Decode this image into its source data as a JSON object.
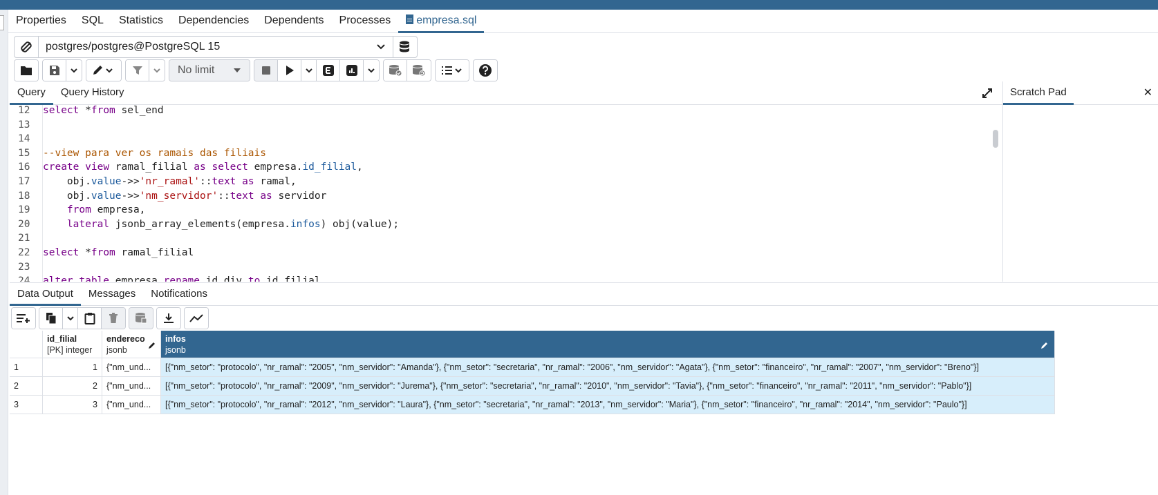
{
  "main_tabs": [
    {
      "label": "Properties"
    },
    {
      "label": "SQL"
    },
    {
      "label": "Statistics"
    },
    {
      "label": "Dependencies"
    },
    {
      "label": "Dependents"
    },
    {
      "label": "Processes"
    },
    {
      "label": "empresa.sql",
      "active": true
    }
  ],
  "connection": {
    "value": "postgres/postgres@PostgreSQL 15"
  },
  "toolbar": {
    "limit_label": "No limit"
  },
  "query_tabs": [
    {
      "label": "Query",
      "active": true
    },
    {
      "label": "Query History"
    }
  ],
  "scratch_pad": {
    "label": "Scratch Pad",
    "close": "✕"
  },
  "editor": {
    "lines": [
      {
        "n": "12",
        "code": "select *from sel_end"
      },
      {
        "n": "13",
        "code": ""
      },
      {
        "n": "14",
        "code": ""
      },
      {
        "n": "15",
        "code": "--view para ver os ramais das filiais"
      },
      {
        "n": "16",
        "code": "create view ramal_filial as select empresa.id_filial,"
      },
      {
        "n": "17",
        "code": "    obj.value->>'nr_ramal'::text as ramal,"
      },
      {
        "n": "18",
        "code": "    obj.value->>'nm_servidor'::text as servidor"
      },
      {
        "n": "19",
        "code": "    from empresa,"
      },
      {
        "n": "20",
        "code": "    lateral jsonb_array_elements(empresa.infos) obj(value);"
      },
      {
        "n": "21",
        "code": ""
      },
      {
        "n": "22",
        "code": "select *from ramal_filial"
      },
      {
        "n": "23",
        "code": ""
      },
      {
        "n": "24",
        "code": "alter table empresa rename id_div to id_filial"
      }
    ]
  },
  "bottom_tabs": [
    {
      "label": "Data Output",
      "active": true
    },
    {
      "label": "Messages"
    },
    {
      "label": "Notifications"
    }
  ],
  "grid": {
    "columns": [
      {
        "name": "",
        "type": ""
      },
      {
        "name": "id_filial",
        "type": "[PK] integer"
      },
      {
        "name": "endereco",
        "type": "jsonb"
      },
      {
        "name": "infos",
        "type": "jsonb"
      }
    ],
    "rows": [
      {
        "rownum": "1",
        "id_filial": "1",
        "endereco": "{\"nm_und...",
        "infos": "[{\"nm_setor\": \"protocolo\", \"nr_ramal\": \"2005\", \"nm_servidor\": \"Amanda\"}, {\"nm_setor\": \"secretaria\", \"nr_ramal\": \"2006\", \"nm_servidor\": \"Agata\"}, {\"nm_setor\": \"financeiro\", \"nr_ramal\": \"2007\", \"nm_servidor\": \"Breno\"}]"
      },
      {
        "rownum": "2",
        "id_filial": "2",
        "endereco": "{\"nm_und...",
        "infos": "[{\"nm_setor\": \"protocolo\", \"nr_ramal\": \"2009\", \"nm_servidor\": \"Jurema\"}, {\"nm_setor\": \"secretaria\", \"nr_ramal\": \"2010\", \"nm_servidor\": \"Tavia\"}, {\"nm_setor\": \"financeiro\", \"nr_ramal\": \"2011\", \"nm_servidor\": \"Pablo\"}]"
      },
      {
        "rownum": "3",
        "id_filial": "3",
        "endereco": "{\"nm_und...",
        "infos": "[{\"nm_setor\": \"protocolo\", \"nr_ramal\": \"2012\", \"nm_servidor\": \"Laura\"}, {\"nm_setor\": \"secretaria\", \"nr_ramal\": \"2013\", \"nm_servidor\": \"Maria\"}, {\"nm_setor\": \"financeiro\", \"nr_ramal\": \"2014\", \"nm_servidor\": \"Paulo\"}]"
      }
    ]
  },
  "colors": {
    "accent": "#326690",
    "selected_cell": "#d7eefb",
    "keyword": "#770088",
    "comment": "#aa5500",
    "string": "#aa1111"
  }
}
